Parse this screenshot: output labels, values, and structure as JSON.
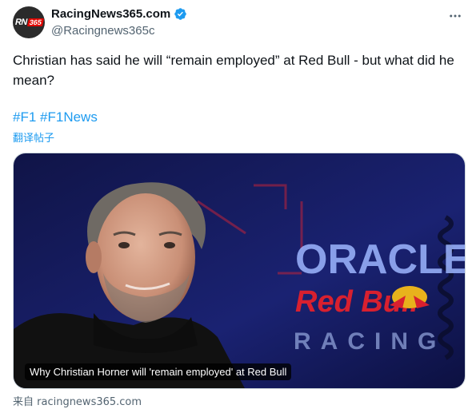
{
  "author": {
    "display_name": "RacingNews365.com",
    "handle": "@Racingnews365c",
    "avatar_text": "RN",
    "avatar_badge": "365",
    "verified": true
  },
  "tweet": {
    "text": "Christian has said he will “remain employed” at Red Bull - but what did he mean?",
    "hashtags": [
      "#F1",
      "#F1News"
    ],
    "translate_label": "翻译帖子"
  },
  "card": {
    "image_text": {
      "brand": "ORACLE",
      "sponsor": "Red Bull",
      "team_word": "RACING"
    },
    "title": "Why Christian Horner will 'remain employed' at Red Bull",
    "source": "来自 racingnews365.com"
  },
  "colors": {
    "accent": "#1d9bf0",
    "text": "#0f1419",
    "muted": "#536471",
    "background_navy": "#141a5c"
  },
  "icons": {
    "verified": "verified-badge-icon",
    "more": "more-options-icon"
  }
}
